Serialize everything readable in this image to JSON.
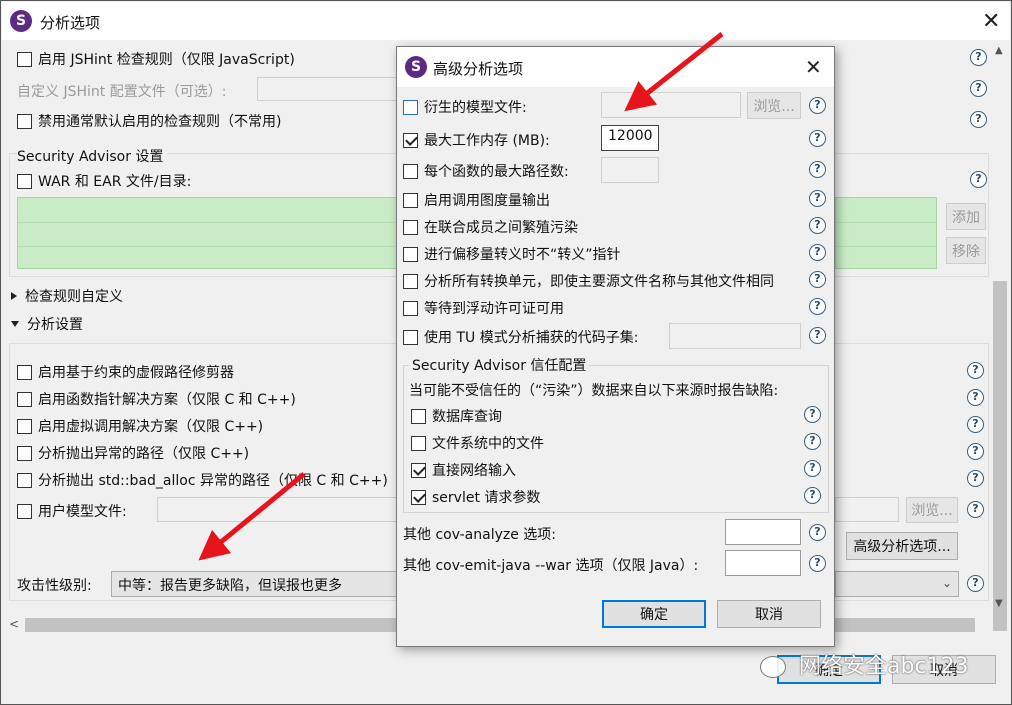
{
  "main_window": {
    "title": "分析选项",
    "rows": {
      "jshint": "启用 JSHint 检查规则（仅限 JavaScript)",
      "jshint_config": "自定义 JSHint 配置文件（可选）:",
      "disable_default": "禁用通常默认启用的检查规则（不常用)",
      "security_advisor_title": "Security Advisor 设置",
      "war_ear": "WAR 和 EAR 文件/目录:",
      "add_btn": "添加",
      "remove_btn": "移除",
      "checker_custom": "检查规则自定义",
      "analysis_settings": "分析设置",
      "constraint_pruner": "启用基于约束的虚假路径修剪器",
      "func_ptr": "启用函数指针解决方案（仅限 C 和 C++)",
      "virtual_call": "启用虚拟调用解决方案（仅限 C++)",
      "exception_paths": "分析抛出异常的路径（仅限 C++)",
      "bad_alloc": "分析抛出 std::bad_alloc 异常的路径（仅限 C 和 C++)",
      "user_model": "用户模型文件:",
      "browse_btn": "浏览...",
      "advanced_btn": "高级分析选项...",
      "aggressiveness_label": "攻击性级别:",
      "aggressiveness_value": "中等：报告更多缺陷，但误报也更多",
      "ok_btn": "确定",
      "cancel_btn": "取消"
    }
  },
  "dialog": {
    "title": "高级分析选项",
    "derived_models": "衍生的模型文件:",
    "browse_btn": "浏览...",
    "max_memory_label": "最大工作内存 (MB):",
    "max_memory_value": "12000",
    "max_paths": "每个函数的最大路径数:",
    "callgraph_metrics": "启用调用图度量输出",
    "taint_union": "在联合成员之间繁殖污染",
    "offset_pointer": "进行偏移量转义时不“转义”指针",
    "all_tus": "分析所有转换单元，即使主要源文件名称与其他文件相同",
    "wait_license": "等待到浮动许可证可用",
    "tu_pattern": "使用 TU 模式分析捕获的代码子集:",
    "trust_group_title": "Security Advisor 信任配置",
    "trust_desc": "当可能不受信任的（“污染”）数据来自以下来源时报告缺陷:",
    "database": "数据库查询",
    "filesystem": "文件系统中的文件",
    "network": "直接网络输入",
    "servlet": "servlet 请求参数",
    "cov_analyze": "其他 cov-analyze 选项:",
    "cov_emit": "其他 cov-emit-java --war 选项（仅限 Java）:",
    "ok_btn": "确定",
    "cancel_btn": "取消"
  },
  "watermark": "网络安全abc123",
  "colors": {
    "accent": "#0078d7",
    "green_list": "#c9ecc6",
    "arrow": "#e8141c"
  }
}
